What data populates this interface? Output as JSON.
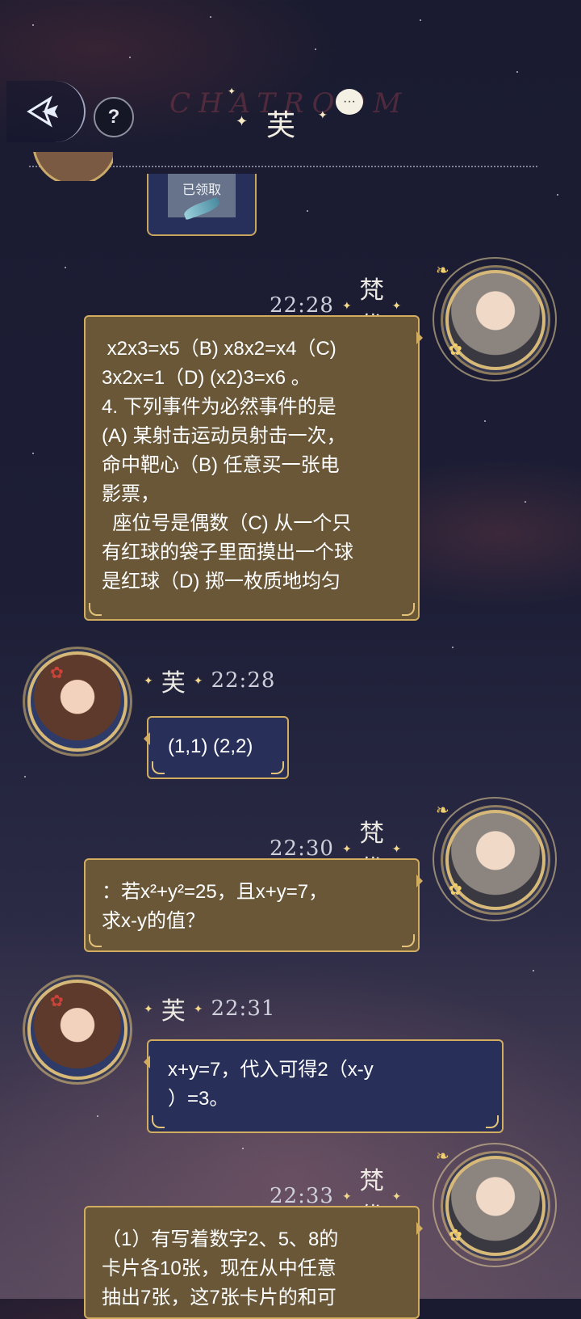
{
  "header": {
    "back_label": "back",
    "help_label": "?",
    "watermark": "CHATROOM",
    "title": "芙",
    "chat_icon": "speech-bubble-icon"
  },
  "top_item": {
    "gift_label": "已领取",
    "icon": "feather-icon"
  },
  "messages": [
    {
      "side": "right",
      "time": "22:28",
      "name": "梵优",
      "lines": [
        " x2x3=x5（B) x8x2=x4（C)",
        "3x2x=1（D) (x2)3=x6 。",
        "4. 下列事件为必然事件的是",
        "(A) 某射击运动员射击一次，",
        "命中靶心（B) 任意买一张电",
        "影票，",
        "  座位号是偶数（C) 从一个只",
        "有红球的袋子里面摸出一个球",
        "是红球（D) 掷一枚质地均匀"
      ]
    },
    {
      "side": "left",
      "time": "22:28",
      "name": "芙",
      "lines": [
        "(1,1) (2,2)"
      ]
    },
    {
      "side": "right",
      "time": "22:30",
      "name": "梵优",
      "lines": [
        "：若x²+y²=25，且x+y=7，",
        "求x-y的值？"
      ]
    },
    {
      "side": "left",
      "time": "22:31",
      "name": "芙",
      "lines": [
        "x+y=7，代入可得2（x-y",
        "）=3。"
      ]
    },
    {
      "side": "right",
      "time": "22:33",
      "name": "梵优",
      "lines": [
        "（1）有写着数字2、5、8的",
        "卡片各10张，现在从中任意",
        "抽出7张，这7张卡片的和可"
      ]
    }
  ]
}
